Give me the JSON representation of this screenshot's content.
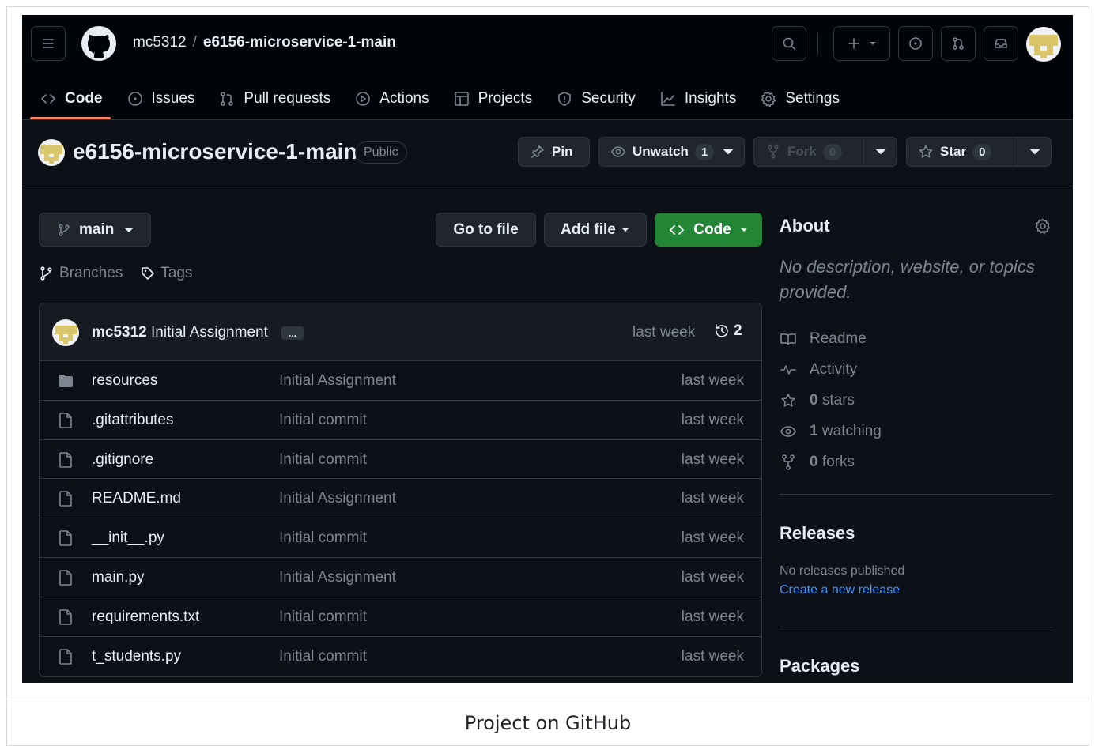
{
  "header": {
    "owner": "mc5312",
    "separator": "/",
    "repo": "e6156-microservice-1-main"
  },
  "nav": {
    "tabs": [
      {
        "label": "Code",
        "icon": "code-icon"
      },
      {
        "label": "Issues",
        "icon": "issue-opened-icon"
      },
      {
        "label": "Pull requests",
        "icon": "git-pull-request-icon"
      },
      {
        "label": "Actions",
        "icon": "play-icon"
      },
      {
        "label": "Projects",
        "icon": "table-icon"
      },
      {
        "label": "Security",
        "icon": "shield-icon"
      },
      {
        "label": "Insights",
        "icon": "graph-icon"
      },
      {
        "label": "Settings",
        "icon": "gear-icon"
      }
    ],
    "active": "Code"
  },
  "repo_bar": {
    "name": "e6156-microservice-1-main",
    "visibility": "Public",
    "pin_label": "Pin",
    "unwatch_label": "Unwatch",
    "watch_count": "1",
    "fork_label": "Fork",
    "fork_count": "0",
    "star_label": "Star",
    "star_count": "0"
  },
  "toolbar": {
    "branch": "main",
    "goto_label": "Go to file",
    "add_label": "Add file",
    "code_label": "Code",
    "branches_label": "Branches",
    "tags_label": "Tags"
  },
  "commit": {
    "author": "mc5312",
    "message": "Initial Assignment",
    "ellipsis": "...",
    "when": "last week",
    "count": "2"
  },
  "files": [
    {
      "name": "resources",
      "type": "folder",
      "message": "Initial Assignment",
      "when": "last week"
    },
    {
      "name": ".gitattributes",
      "type": "file",
      "message": "Initial commit",
      "when": "last week"
    },
    {
      "name": ".gitignore",
      "type": "file",
      "message": "Initial commit",
      "when": "last week"
    },
    {
      "name": "README.md",
      "type": "file",
      "message": "Initial Assignment",
      "when": "last week"
    },
    {
      "name": "__init__.py",
      "type": "file",
      "message": "Initial commit",
      "when": "last week"
    },
    {
      "name": "main.py",
      "type": "file",
      "message": "Initial Assignment",
      "when": "last week"
    },
    {
      "name": "requirements.txt",
      "type": "file",
      "message": "Initial commit",
      "when": "last week"
    },
    {
      "name": "t_students.py",
      "type": "file",
      "message": "Initial commit",
      "when": "last week"
    }
  ],
  "about": {
    "title": "About",
    "description": "No description, website, or topics provided.",
    "items": [
      {
        "icon": "book-icon",
        "bold": "",
        "label": "Readme"
      },
      {
        "icon": "pulse-icon",
        "bold": "",
        "label": "Activity"
      },
      {
        "icon": "star-icon",
        "bold": "0",
        "label": "stars"
      },
      {
        "icon": "eye-icon",
        "bold": "1",
        "label": "watching"
      },
      {
        "icon": "repo-forked-icon",
        "bold": "0",
        "label": "forks"
      }
    ]
  },
  "releases": {
    "title": "Releases",
    "none_text": "No releases published",
    "create_link": "Create a new release"
  },
  "packages": {
    "title": "Packages"
  },
  "caption": "Project on GitHub",
  "colors": {
    "background": "#0d1117",
    "header": "#010409",
    "accent_underline": "#f78166",
    "code_button": "#238636",
    "link": "#4493f8"
  }
}
